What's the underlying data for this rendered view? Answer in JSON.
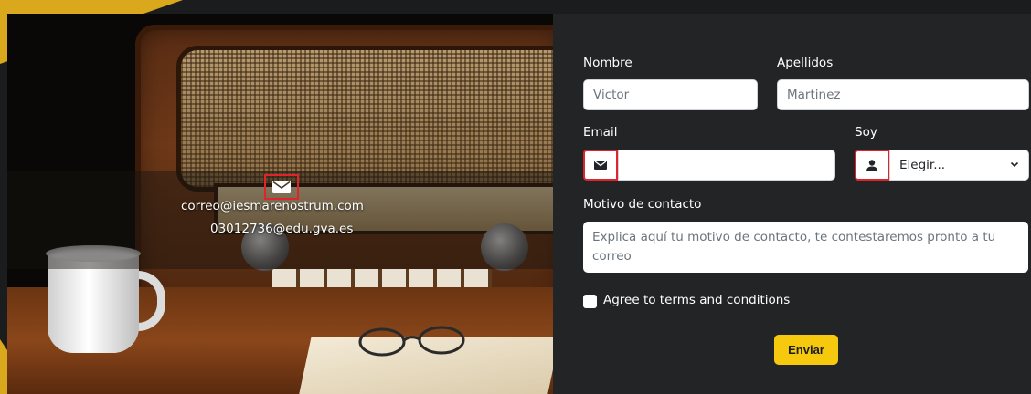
{
  "contact": {
    "email_icon": "envelope-icon",
    "email": "correo@iesmarenostrum.com",
    "alt_email": "03012736@edu.gva.es"
  },
  "form": {
    "nombre": {
      "label": "Nombre",
      "placeholder": "Victor"
    },
    "apellidos": {
      "label": "Apellidos",
      "placeholder": "Martinez"
    },
    "email": {
      "label": "Email",
      "icon": "envelope-icon",
      "value": ""
    },
    "soy": {
      "label": "Soy",
      "icon": "user-icon",
      "selected": "Elegir..."
    },
    "motivo": {
      "label": "Motivo de contacto",
      "placeholder": "Explica aquí tu motivo de contacto, te contestaremos pronto a tu correo"
    },
    "terms_label": "Agree to terms and conditions",
    "submit_label": "Enviar"
  },
  "colors": {
    "accent": "#f6c90e",
    "highlight": "#e0242b",
    "corner": "#d9a81c"
  }
}
